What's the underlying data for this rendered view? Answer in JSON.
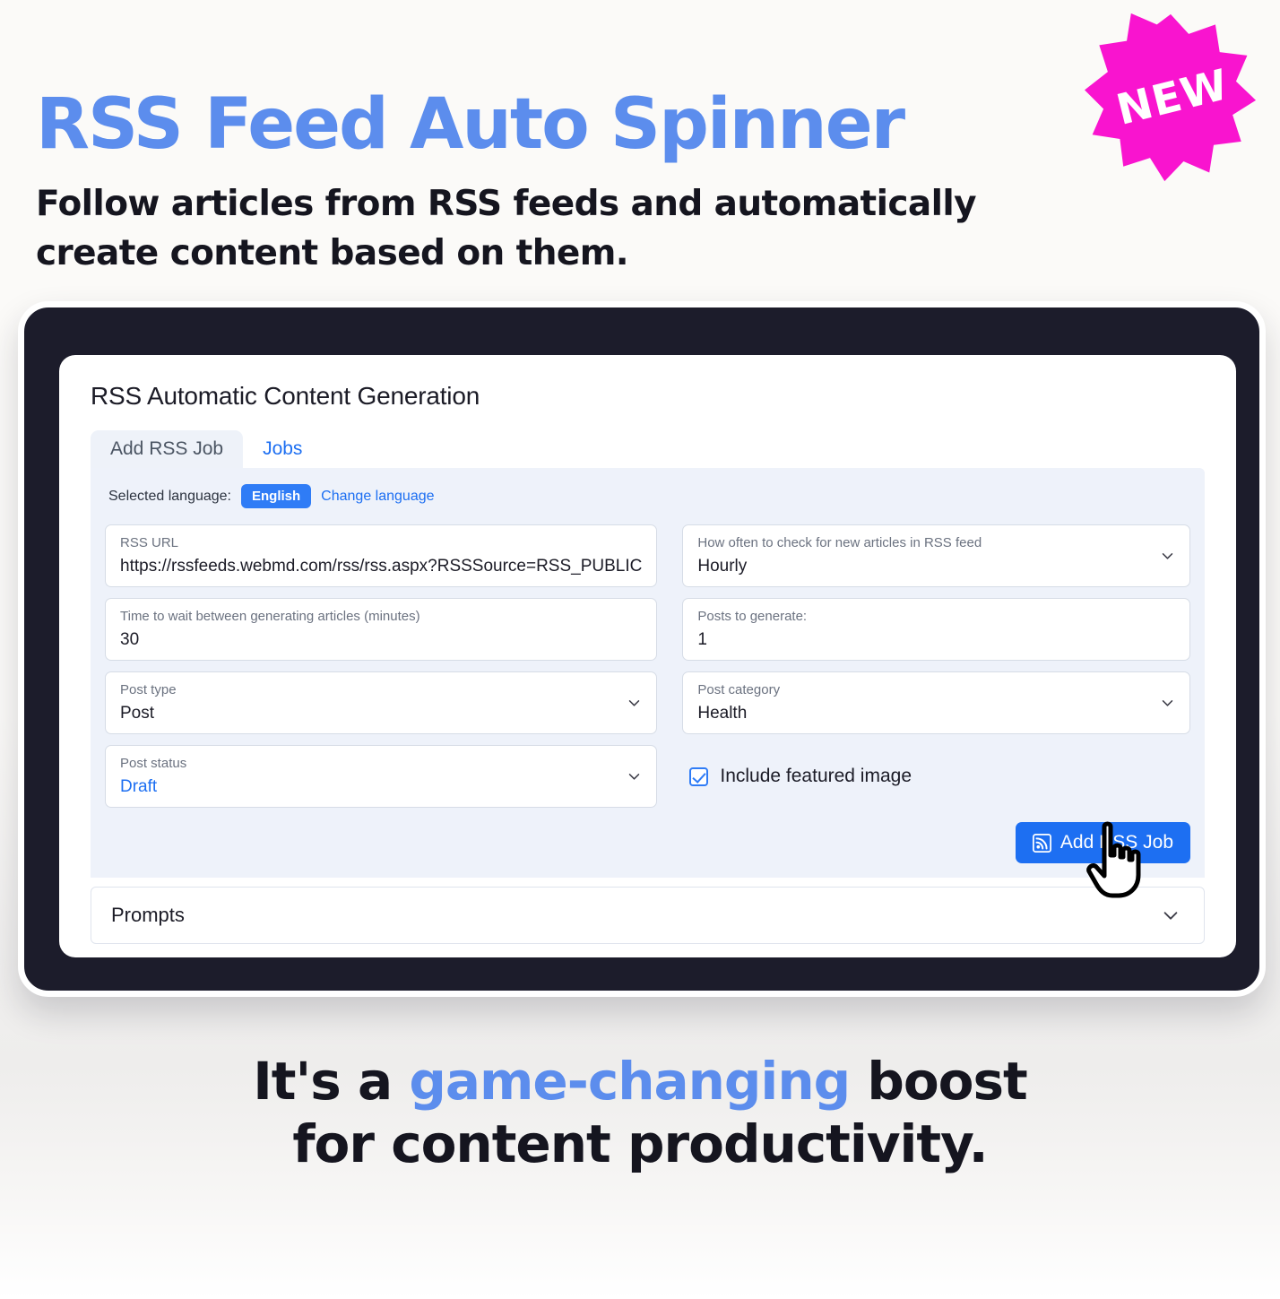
{
  "hero": {
    "title": "RSS Feed Auto Spinner",
    "subtitle": "Follow articles from RSS feeds and automatically create content based on them.",
    "badge": "NEW",
    "badge_color": "#f914cf",
    "title_color": "#5c8ded"
  },
  "app": {
    "card_title": "RSS Automatic Content Generation",
    "tabs": [
      {
        "label": "Add RSS Job",
        "active": true
      },
      {
        "label": "Jobs",
        "active": false
      }
    ],
    "language": {
      "label": "Selected language:",
      "value": "English",
      "change_link": "Change language"
    },
    "fields": {
      "rss_url": {
        "label": "RSS URL",
        "value": "https://rssfeeds.webmd.com/rss/rss.aspx?RSSSource=RSS_PUBLIC"
      },
      "frequency": {
        "label": "How often to check for new articles in RSS feed",
        "value": "Hourly"
      },
      "wait_time": {
        "label": "Time to wait between generating articles (minutes)",
        "value": "30"
      },
      "posts_to_generate": {
        "label": "Posts to generate:",
        "value": "1"
      },
      "post_type": {
        "label": "Post type",
        "value": "Post"
      },
      "post_category": {
        "label": "Post category",
        "value": "Health"
      },
      "post_status": {
        "label": "Post status",
        "value": "Draft"
      }
    },
    "featured_image": {
      "label": "Include featured image",
      "checked": true
    },
    "submit_button": "Add RSS Job",
    "prompts": {
      "label": "Prompts"
    }
  },
  "footer": {
    "line1_a": "It's a ",
    "line1_hl": "game-changing",
    "line1_b": " boost",
    "line2": "for content productivity."
  }
}
